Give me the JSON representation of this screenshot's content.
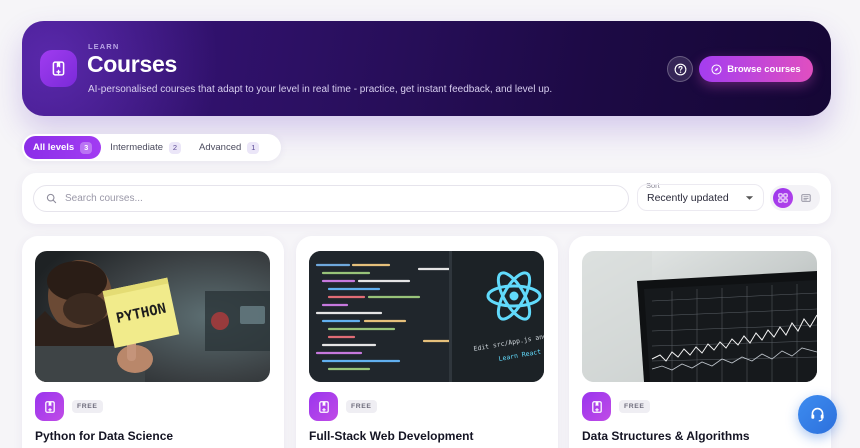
{
  "hero": {
    "eyebrow": "LEARN",
    "title": "Courses",
    "subtitle": "AI-personalised courses that adapt to your level in real time - practice, get instant feedback, and level up.",
    "browse_label": "Browse courses"
  },
  "filters": [
    {
      "label": "All levels",
      "count": "3",
      "active": true
    },
    {
      "label": "Intermediate",
      "count": "2",
      "active": false
    },
    {
      "label": "Advanced",
      "count": "1",
      "active": false
    }
  ],
  "search": {
    "placeholder": "Search courses...",
    "value": ""
  },
  "sort": {
    "label": "Sort",
    "selected": "Recently updated"
  },
  "view": {
    "selected": "grid"
  },
  "courses": [
    {
      "title": "Python for Data Science",
      "badge": "FREE",
      "image": "sticky note reading PYTHON",
      "note_text": "PYTHON"
    },
    {
      "title": "Full-Stack Web Development",
      "badge": "FREE",
      "image": "code editor with React logo",
      "code_caption_1": "Edit src/App.js and save to",
      "code_caption_2": "Learn React"
    },
    {
      "title": "Data Structures & Algorithms",
      "badge": "FREE",
      "image": "laptop showing stock chart"
    }
  ],
  "colors": {
    "accent": "#8b2ee8",
    "accent_pink": "#e04fc0",
    "hero_bg": "#2c1063",
    "support": "#2d70dc"
  },
  "icons": {
    "hero": "book-icon",
    "help": "question-icon",
    "browse": "compass-icon",
    "search": "search-icon",
    "grid": "grid-icon",
    "list": "list-icon",
    "support": "headset-icon"
  }
}
